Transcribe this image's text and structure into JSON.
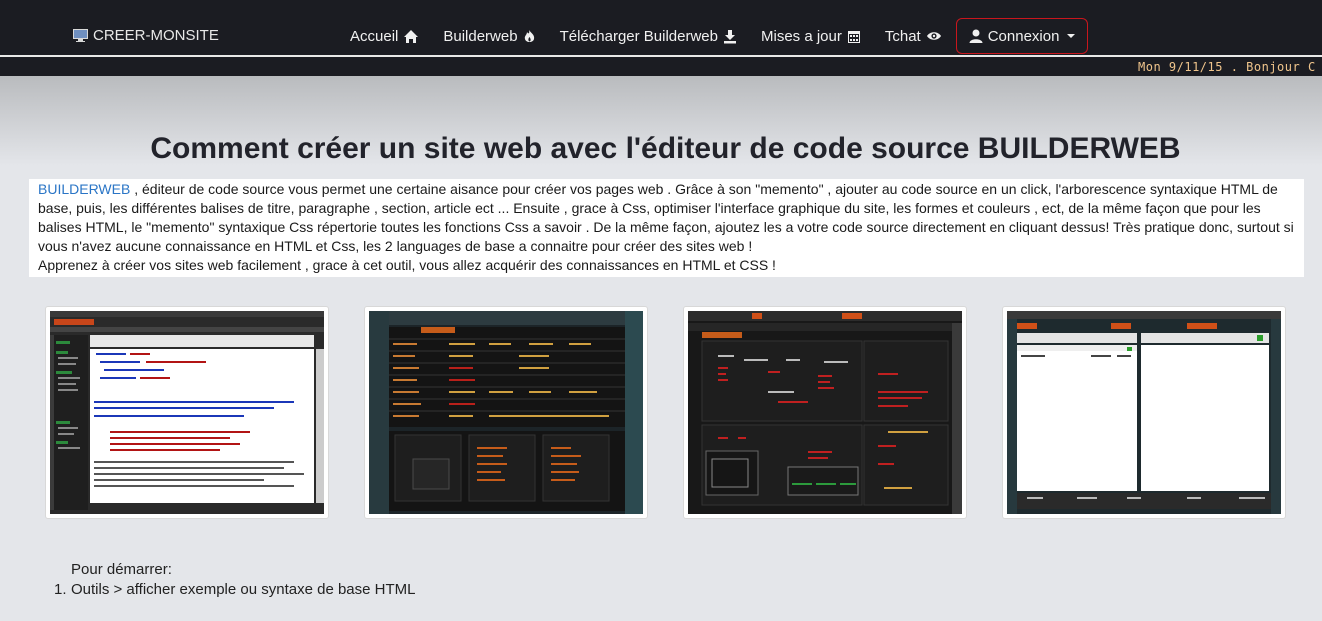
{
  "nav": {
    "brand": "CREER-MONSITE",
    "items": [
      {
        "label": "Accueil",
        "icon": "home-icon"
      },
      {
        "label": "Builderweb",
        "icon": "fire-icon"
      },
      {
        "label": "Télécharger Builderweb",
        "icon": "download-icon"
      },
      {
        "label": "Mises a jour",
        "icon": "calendar-icon"
      },
      {
        "label": "Tchat",
        "icon": "eye-icon"
      }
    ],
    "connexion": "Connexion",
    "accent": "#c9161d"
  },
  "ticker": "Mon 9/11/15 . Bonjour C",
  "page": {
    "title": "Comment créer un site web avec l'éditeur de code source BUILDERWEB",
    "intro_link": "BUILDERWEB",
    "intro_line1": " , éditeur de code source vous permet une certaine aisance pour créer vos pages web . Grâce à son \"memento\" , ajouter au code source en un click, l'arborescence syntaxique HTML de base, puis, les différentes balises de titre, paragraphe , section, article ect ... Ensuite , grace à Css, optimiser l'interface graphique du site, les formes et couleurs , ect, de la même façon que pour les balises HTML, le \"memento\" syntaxique Css répertorie toutes les fonctions Css a savoir . De la même façon, ajoutez les a votre code source directement en cliquant dessus! Très pratique donc, surtout si vous n'avez aucune connaissance en HTML et Css, les 2 languages de base a connaitre pour créer des sites web !",
    "intro_line2": "Apprenez à créer vos sites web facilement , grace à cet outil, vous allez acquérir des connaissances en HTML et CSS !"
  },
  "start": {
    "title": "Pour démarrer:",
    "steps": [
      {
        "num": "1.",
        "text": "Outils > afficher exemple ou syntaxe de base HTML"
      }
    ]
  },
  "screenshots": [
    {
      "name": "screenshot-editor"
    },
    {
      "name": "screenshot-css-memento"
    },
    {
      "name": "screenshot-html-memento"
    },
    {
      "name": "screenshot-ftp"
    }
  ]
}
